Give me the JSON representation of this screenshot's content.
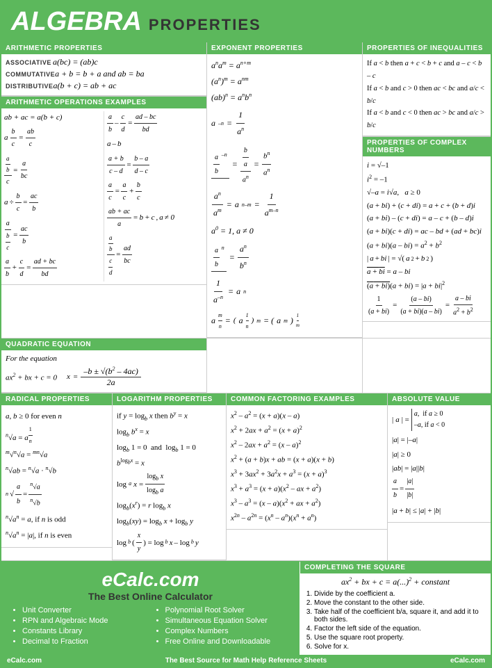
{
  "header": {
    "algebra": "ALGEBRA",
    "properties": "PROPERTIES"
  },
  "sections": {
    "arithmetic_props": {
      "title": "ARITHMETIC PROPERTIES",
      "rows": [
        {
          "label": "ASSOCIATIVE",
          "formula": "a(bc) = (ab)c"
        },
        {
          "label": "COMMUTATIVE",
          "formula": "a + b = b + a and ab = ba"
        },
        {
          "label": "DISTRIBUTIVE",
          "formula": "a(b + c) = ab + ac"
        }
      ]
    },
    "arithmetic_ops": {
      "title": "ARITHMETIC OPERATIONS EXAMPLES"
    },
    "exponent_props": {
      "title": "EXPONENT PROPERTIES"
    },
    "inequalities": {
      "title": "PROPERTIES OF INEQUALITIES"
    },
    "complex_numbers": {
      "title": "PROPERTIES OF COMPLEX NUMBERS"
    },
    "quadratic": {
      "title": "QUADRATIC EQUATION"
    },
    "radical": {
      "title": "RADICAL PROPERTIES"
    },
    "logarithm": {
      "title": "LOGARITHM PROPERTIES"
    },
    "factoring": {
      "title": "COMMON FACTORING EXAMPLES"
    },
    "absolute": {
      "title": "ABSOLUTE VALUE"
    },
    "completing": {
      "title": "COMPLETING THE SQUARE",
      "steps": [
        "Divide by the coefficient a.",
        "Move the constant to the other side.",
        "Take half of the coefficient b/a, square it, and add it  to both sides.",
        "Factor the left side of the equation.",
        "Use the square root property.",
        "Solve for x."
      ]
    }
  },
  "ecalc": {
    "title": "eCalc.com",
    "subtitle": "The Best Online Calculator",
    "bullets_left": [
      "Unit Converter",
      "RPN and Algebraic Mode",
      "Constants Library",
      "Decimal to Fraction"
    ],
    "bullets_right": [
      "Polynomial Root Solver",
      "Simultaneous Equation Solver",
      "Complex Numbers",
      "Free Online and Downloadable"
    ]
  },
  "footer": {
    "left": "eCalc.com",
    "center": "The Best Source for Math Help Reference Sheets",
    "right": "eCalc.com"
  }
}
